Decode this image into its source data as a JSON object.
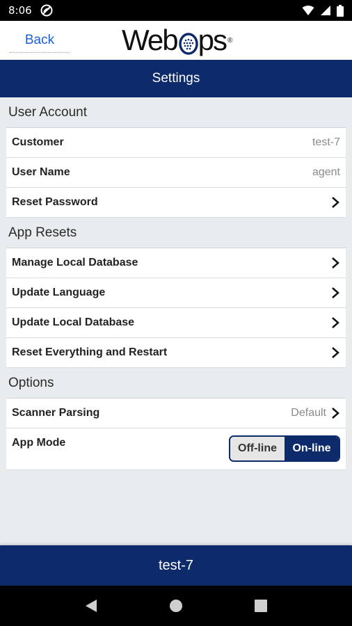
{
  "status_bar": {
    "time": "8:06",
    "icons": [
      "do-not-disturb-icon",
      "wifi-icon",
      "signal-icon",
      "battery-icon"
    ]
  },
  "header": {
    "back_label": "Back",
    "logo_text_left": "Web",
    "logo_text_right": "ps",
    "logo_reg": "®"
  },
  "title_bar": {
    "title": "Settings"
  },
  "sections": {
    "user_account": {
      "title": "User Account",
      "customer_label": "Customer",
      "customer_value": "test-7",
      "username_label": "User Name",
      "username_value": "agent",
      "reset_password_label": "Reset Password"
    },
    "app_resets": {
      "title": "App Resets",
      "manage_db_label": "Manage Local Database",
      "update_language_label": "Update Language",
      "update_db_label": "Update Local Database",
      "reset_everything_label": "Reset Everything and Restart"
    },
    "options": {
      "title": "Options",
      "scanner_label": "Scanner Parsing",
      "scanner_value": "Default",
      "app_mode_label": "App Mode",
      "mode_off": "Off-line",
      "mode_on": "On-line",
      "mode_selected": "On-line"
    }
  },
  "footer": {
    "text": "test-7"
  },
  "colors": {
    "brand_navy": "#0d2a6b",
    "link_blue": "#1f5fd6",
    "background": "#e9ecef"
  }
}
